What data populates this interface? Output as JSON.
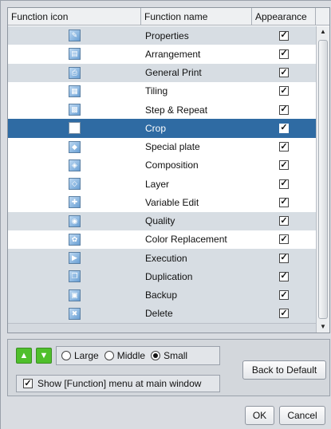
{
  "table": {
    "headers": [
      "Function icon",
      "Function name",
      "Appearance"
    ],
    "rows": [
      {
        "name": "Properties",
        "icon": "properties-icon",
        "glyph": "✎",
        "checked": true,
        "shaded": true,
        "selected": false
      },
      {
        "name": "Arrangement",
        "icon": "arrangement-icon",
        "glyph": "▤",
        "checked": true,
        "shaded": false,
        "selected": false
      },
      {
        "name": "General Print",
        "icon": "general-print-icon",
        "glyph": "⎙",
        "checked": true,
        "shaded": true,
        "selected": false
      },
      {
        "name": "Tiling",
        "icon": "tiling-icon",
        "glyph": "▦",
        "checked": true,
        "shaded": false,
        "selected": false
      },
      {
        "name": "Step & Repeat",
        "icon": "step-repeat-icon",
        "glyph": "▩",
        "checked": true,
        "shaded": false,
        "selected": false
      },
      {
        "name": "Crop",
        "icon": "crop-icon",
        "glyph": "□",
        "checked": true,
        "shaded": false,
        "selected": true
      },
      {
        "name": "Special plate",
        "icon": "special-plate-icon",
        "glyph": "◆",
        "checked": true,
        "shaded": false,
        "selected": false
      },
      {
        "name": "Composition",
        "icon": "composition-icon",
        "glyph": "◈",
        "checked": true,
        "shaded": false,
        "selected": false
      },
      {
        "name": "Layer",
        "icon": "layer-icon",
        "glyph": "◇",
        "checked": true,
        "shaded": false,
        "selected": false
      },
      {
        "name": "Variable Edit",
        "icon": "variable-edit-icon",
        "glyph": "✚",
        "checked": true,
        "shaded": false,
        "selected": false
      },
      {
        "name": "Quality",
        "icon": "quality-icon",
        "glyph": "◉",
        "checked": true,
        "shaded": true,
        "selected": false
      },
      {
        "name": "Color Replacement",
        "icon": "color-replacement-icon",
        "glyph": "✿",
        "checked": true,
        "shaded": false,
        "selected": false
      },
      {
        "name": "Execution",
        "icon": "execution-icon",
        "glyph": "▶",
        "checked": true,
        "shaded": true,
        "selected": false
      },
      {
        "name": "Duplication",
        "icon": "duplication-icon",
        "glyph": "❐",
        "checked": true,
        "shaded": true,
        "selected": false
      },
      {
        "name": "Backup",
        "icon": "backup-icon",
        "glyph": "▣",
        "checked": true,
        "shaded": true,
        "selected": false
      },
      {
        "name": "Delete",
        "icon": "delete-icon",
        "glyph": "✖",
        "checked": true,
        "shaded": true,
        "selected": false
      }
    ]
  },
  "controls": {
    "size_options": [
      {
        "label": "Large",
        "selected": false
      },
      {
        "label": "Middle",
        "selected": false
      },
      {
        "label": "Small",
        "selected": true
      }
    ],
    "show_menu_label": "Show [Function] menu at main window",
    "show_menu_checked": true,
    "back_to_default": "Back to Default",
    "ok": "OK",
    "cancel": "Cancel",
    "move_up_icon": "arrow-up-icon",
    "move_down_icon": "arrow-down-icon"
  },
  "colors": {
    "selected_row": "#2f6ba3",
    "shaded_row": "#d7dde3",
    "arrow_button": "#4fbf2b"
  }
}
